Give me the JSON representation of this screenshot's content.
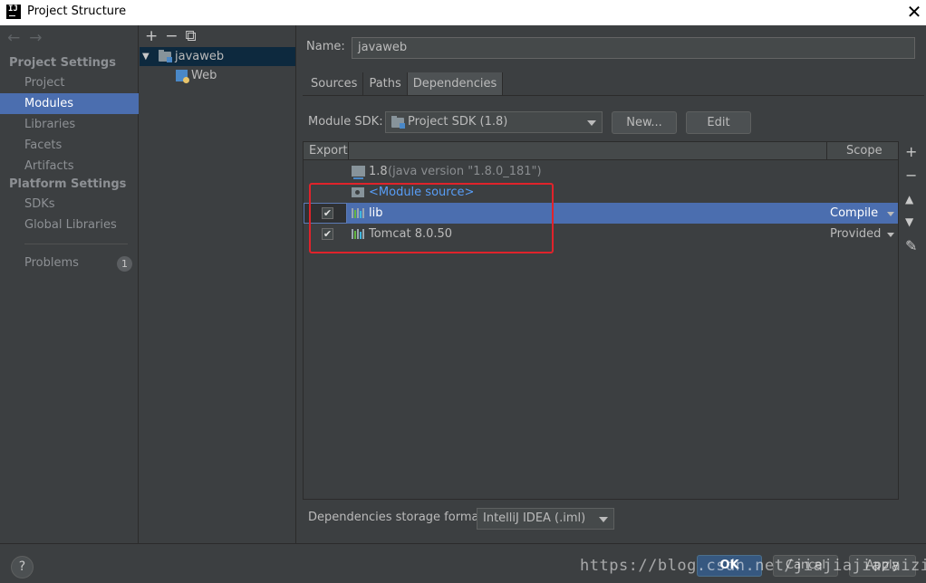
{
  "window": {
    "title": "Project Structure",
    "logo_text": "IJ",
    "close_glyph": "✕"
  },
  "nav": {
    "back": "←",
    "forward": "→"
  },
  "sidebar": {
    "project_settings_header": "Project Settings",
    "project_settings": [
      "Project",
      "Modules",
      "Libraries",
      "Facets",
      "Artifacts"
    ],
    "platform_settings_header": "Platform Settings",
    "platform_settings": [
      "SDKs",
      "Global Libraries"
    ],
    "problems_label": "Problems",
    "problems_count": "1",
    "selected": "Modules"
  },
  "tree": {
    "tools": {
      "add": "+",
      "remove": "−",
      "copy": "⧉"
    },
    "expand_glyph": "▼",
    "module_name": "javaweb",
    "facet_name": "Web"
  },
  "module": {
    "name_label": "Name:",
    "name_value": "javaweb",
    "tabs": [
      "Sources",
      "Paths",
      "Dependencies"
    ],
    "active_tab": "Dependencies",
    "sdk_label": "Module SDK:",
    "sdk_value": "Project SDK (1.8)",
    "new_button": "New...",
    "edit_button": "Edit"
  },
  "dependencies": {
    "col_export": "Export",
    "col_scope": "Scope",
    "jdk_name": "1.8",
    "jdk_detail": "(java version \"1.8.0_181\")",
    "module_source": "<Module source>",
    "rows": [
      {
        "name": "lib",
        "exported": true,
        "check": "✔",
        "scope": "Compile",
        "selected": true
      },
      {
        "name": "Tomcat 8.0.50",
        "exported": true,
        "check": "✔",
        "scope": "Provided",
        "selected": false
      }
    ],
    "side_tools": {
      "add": "+",
      "remove": "−",
      "up": "▲",
      "down": "▼",
      "edit": "✎"
    },
    "storage_label": "Dependencies storage format:",
    "storage_value": "IntelliJ IDEA (.iml)"
  },
  "footer": {
    "help": "?",
    "ok": "OK",
    "cancel": "Cancel",
    "apply": "Apply",
    "watermark": "https://blog.csdn.net/jiajiajiazaizia"
  },
  "colors": {
    "selection": "#4b6eaf",
    "highlight_box": "#e0232b",
    "background": "#3c3f41",
    "link": "#589df6"
  }
}
